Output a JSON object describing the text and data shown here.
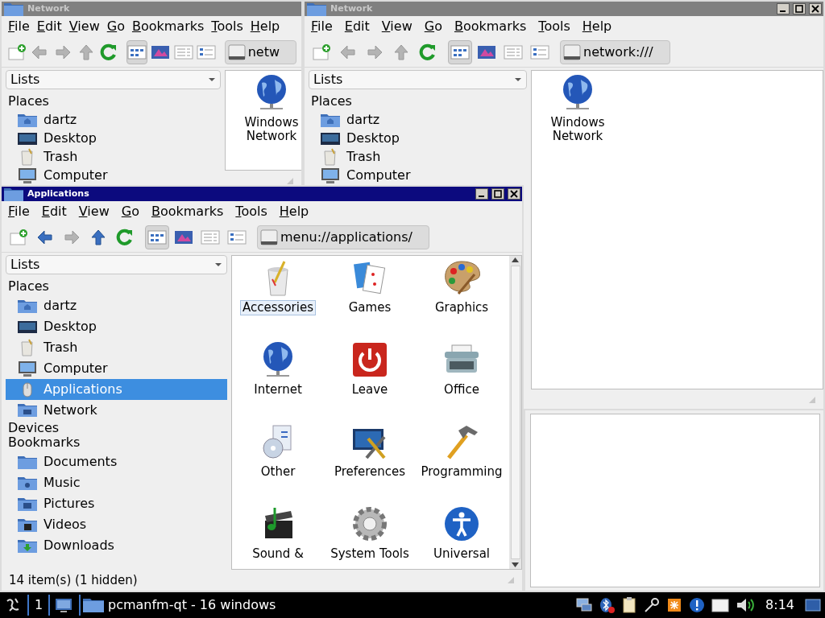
{
  "network_window_back": {
    "title": "Network",
    "active": false,
    "menu": [
      "File",
      "Edit",
      "View",
      "Go",
      "Bookmarks",
      "Tools",
      "Help"
    ],
    "toolbar": {
      "back": {
        "disabled": true
      },
      "forward": {
        "disabled": true
      },
      "up": {
        "disabled": true
      },
      "views": [
        {
          "selected": true
        },
        {
          "selected": false
        },
        {
          "selected": false
        },
        {
          "selected": false
        }
      ],
      "location": "netw"
    },
    "lists": "Lists",
    "sidebar": [
      {
        "heading": "Places",
        "items": [
          {
            "label": "dartz",
            "kind": "home",
            "selected": false
          },
          {
            "label": "Desktop",
            "kind": "desktop",
            "selected": false
          },
          {
            "label": "Trash",
            "kind": "trash",
            "selected": false
          },
          {
            "label": "Computer",
            "kind": "computer",
            "selected": false
          }
        ]
      }
    ],
    "items": [
      {
        "label": "Windows Network",
        "kind": "globe",
        "selected": false
      }
    ]
  },
  "network_window": {
    "title": "Network",
    "active": false,
    "window_buttons": [
      {
        "kind": "minimize"
      },
      {
        "kind": "maximize"
      },
      {
        "kind": "close"
      }
    ],
    "menu": [
      "File",
      "Edit",
      "View",
      "Go",
      "Bookmarks",
      "Tools",
      "Help"
    ],
    "toolbar": {
      "back": {
        "disabled": true
      },
      "forward": {
        "disabled": true
      },
      "up": {
        "disabled": true
      },
      "views": [
        {
          "selected": true
        },
        {
          "selected": false
        },
        {
          "selected": false
        },
        {
          "selected": false
        }
      ],
      "location": "network:///"
    },
    "lists": "Lists",
    "sidebar": [
      {
        "heading": "Places",
        "items": [
          {
            "label": "dartz",
            "kind": "home",
            "selected": false
          },
          {
            "label": "Desktop",
            "kind": "desktop",
            "selected": false
          },
          {
            "label": "Trash",
            "kind": "trash",
            "selected": false
          },
          {
            "label": "Computer",
            "kind": "computer",
            "selected": false
          }
        ]
      }
    ],
    "items": [
      {
        "label": "Windows Network",
        "kind": "globe",
        "selected": false
      }
    ]
  },
  "applications_window": {
    "title": "Applications",
    "active": true,
    "window_buttons": [
      {
        "kind": "minimize"
      },
      {
        "kind": "maximize"
      },
      {
        "kind": "close"
      }
    ],
    "menu": [
      "File",
      "Edit",
      "View",
      "Go",
      "Bookmarks",
      "Tools",
      "Help"
    ],
    "toolbar": {
      "back": {
        "disabled": false
      },
      "forward": {
        "disabled": true
      },
      "up": {
        "disabled": false
      },
      "views": [
        {
          "selected": true
        },
        {
          "selected": false
        },
        {
          "selected": false
        },
        {
          "selected": false
        }
      ],
      "location": "menu://applications/"
    },
    "lists": "Lists",
    "sidebar": [
      {
        "heading": "Places",
        "items": [
          {
            "label": "dartz",
            "kind": "home",
            "selected": false
          },
          {
            "label": "Desktop",
            "kind": "desktop",
            "selected": false
          },
          {
            "label": "Trash",
            "kind": "trash",
            "selected": false
          },
          {
            "label": "Computer",
            "kind": "computer",
            "selected": false
          },
          {
            "label": "Applications",
            "kind": "applications",
            "selected": true
          },
          {
            "label": "Network",
            "kind": "network",
            "selected": false
          }
        ]
      },
      {
        "heading": "Devices"
      },
      {
        "heading": "Bookmarks",
        "items": [
          {
            "label": "Documents",
            "kind": "folder",
            "selected": false
          },
          {
            "label": "Music",
            "kind": "music",
            "selected": false
          },
          {
            "label": "Pictures",
            "kind": "pictures",
            "selected": false
          },
          {
            "label": "Videos",
            "kind": "videos",
            "selected": false
          },
          {
            "label": "Downloads",
            "kind": "downloads",
            "selected": false
          }
        ]
      }
    ],
    "items": [
      {
        "label": "Accessories",
        "kind": "accessories",
        "selected": true
      },
      {
        "label": "Games",
        "kind": "games",
        "selected": false
      },
      {
        "label": "Graphics",
        "kind": "graphics",
        "selected": false
      },
      {
        "label": "Internet",
        "kind": "globe",
        "selected": false
      },
      {
        "label": "Leave",
        "kind": "leave",
        "selected": false
      },
      {
        "label": "Office",
        "kind": "office",
        "selected": false
      },
      {
        "label": "Other",
        "kind": "other",
        "selected": false
      },
      {
        "label": "Preferences",
        "kind": "preferences",
        "selected": false
      },
      {
        "label": "Programming",
        "kind": "programming",
        "selected": false
      },
      {
        "label": "Sound &",
        "kind": "sound",
        "selected": false
      },
      {
        "label": "System Tools",
        "kind": "system",
        "selected": false
      },
      {
        "label": "Universal",
        "kind": "universal",
        "selected": false
      }
    ],
    "status": "14 item(s) (1 hidden)"
  },
  "taskbar": {
    "desktop": "1",
    "tasks": [
      {
        "label": "pcmanfm-qt - 16 windows"
      }
    ],
    "clock": "8:14"
  }
}
